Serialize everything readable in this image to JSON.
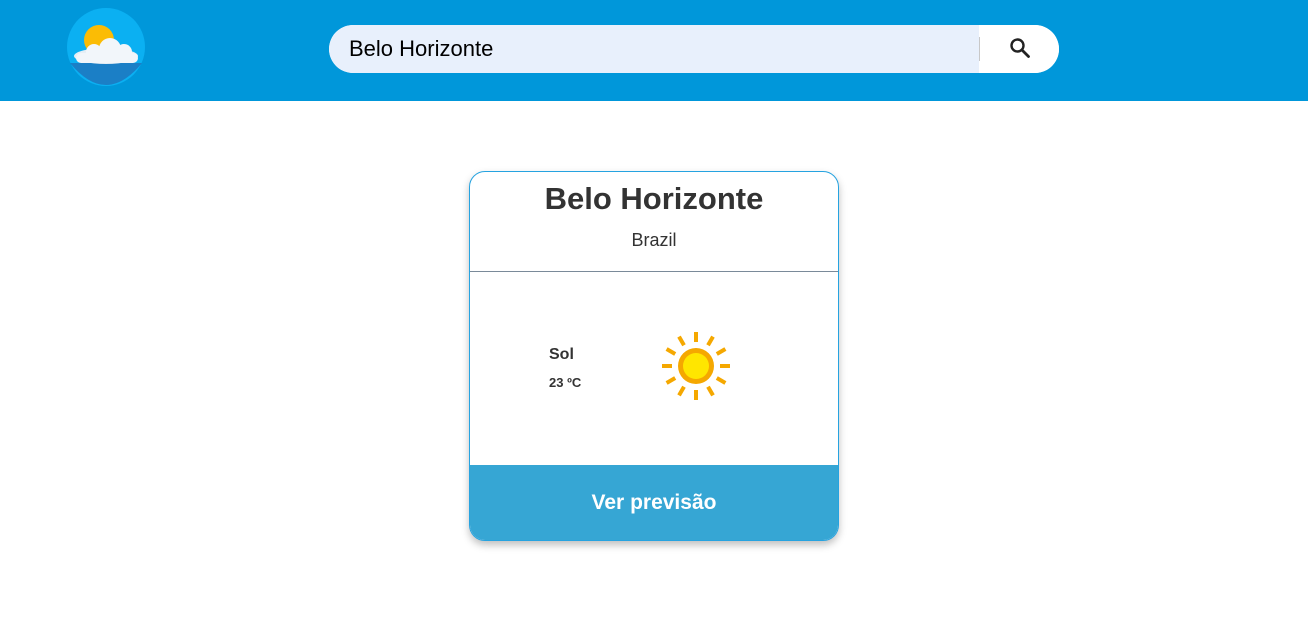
{
  "header": {
    "logo_icon": "sun-cloud-logo-icon",
    "background": "#0097da"
  },
  "search": {
    "value": "Belo Horizonte",
    "placeholder": "",
    "button_icon": "search-icon"
  },
  "card": {
    "city": "Belo Horizonte",
    "country": "Brazil",
    "condition": "Sol",
    "temperature": "23 ºC",
    "weather_icon": "sun-icon",
    "button_label": "Ver previsão",
    "accent": "#36a6d4"
  }
}
